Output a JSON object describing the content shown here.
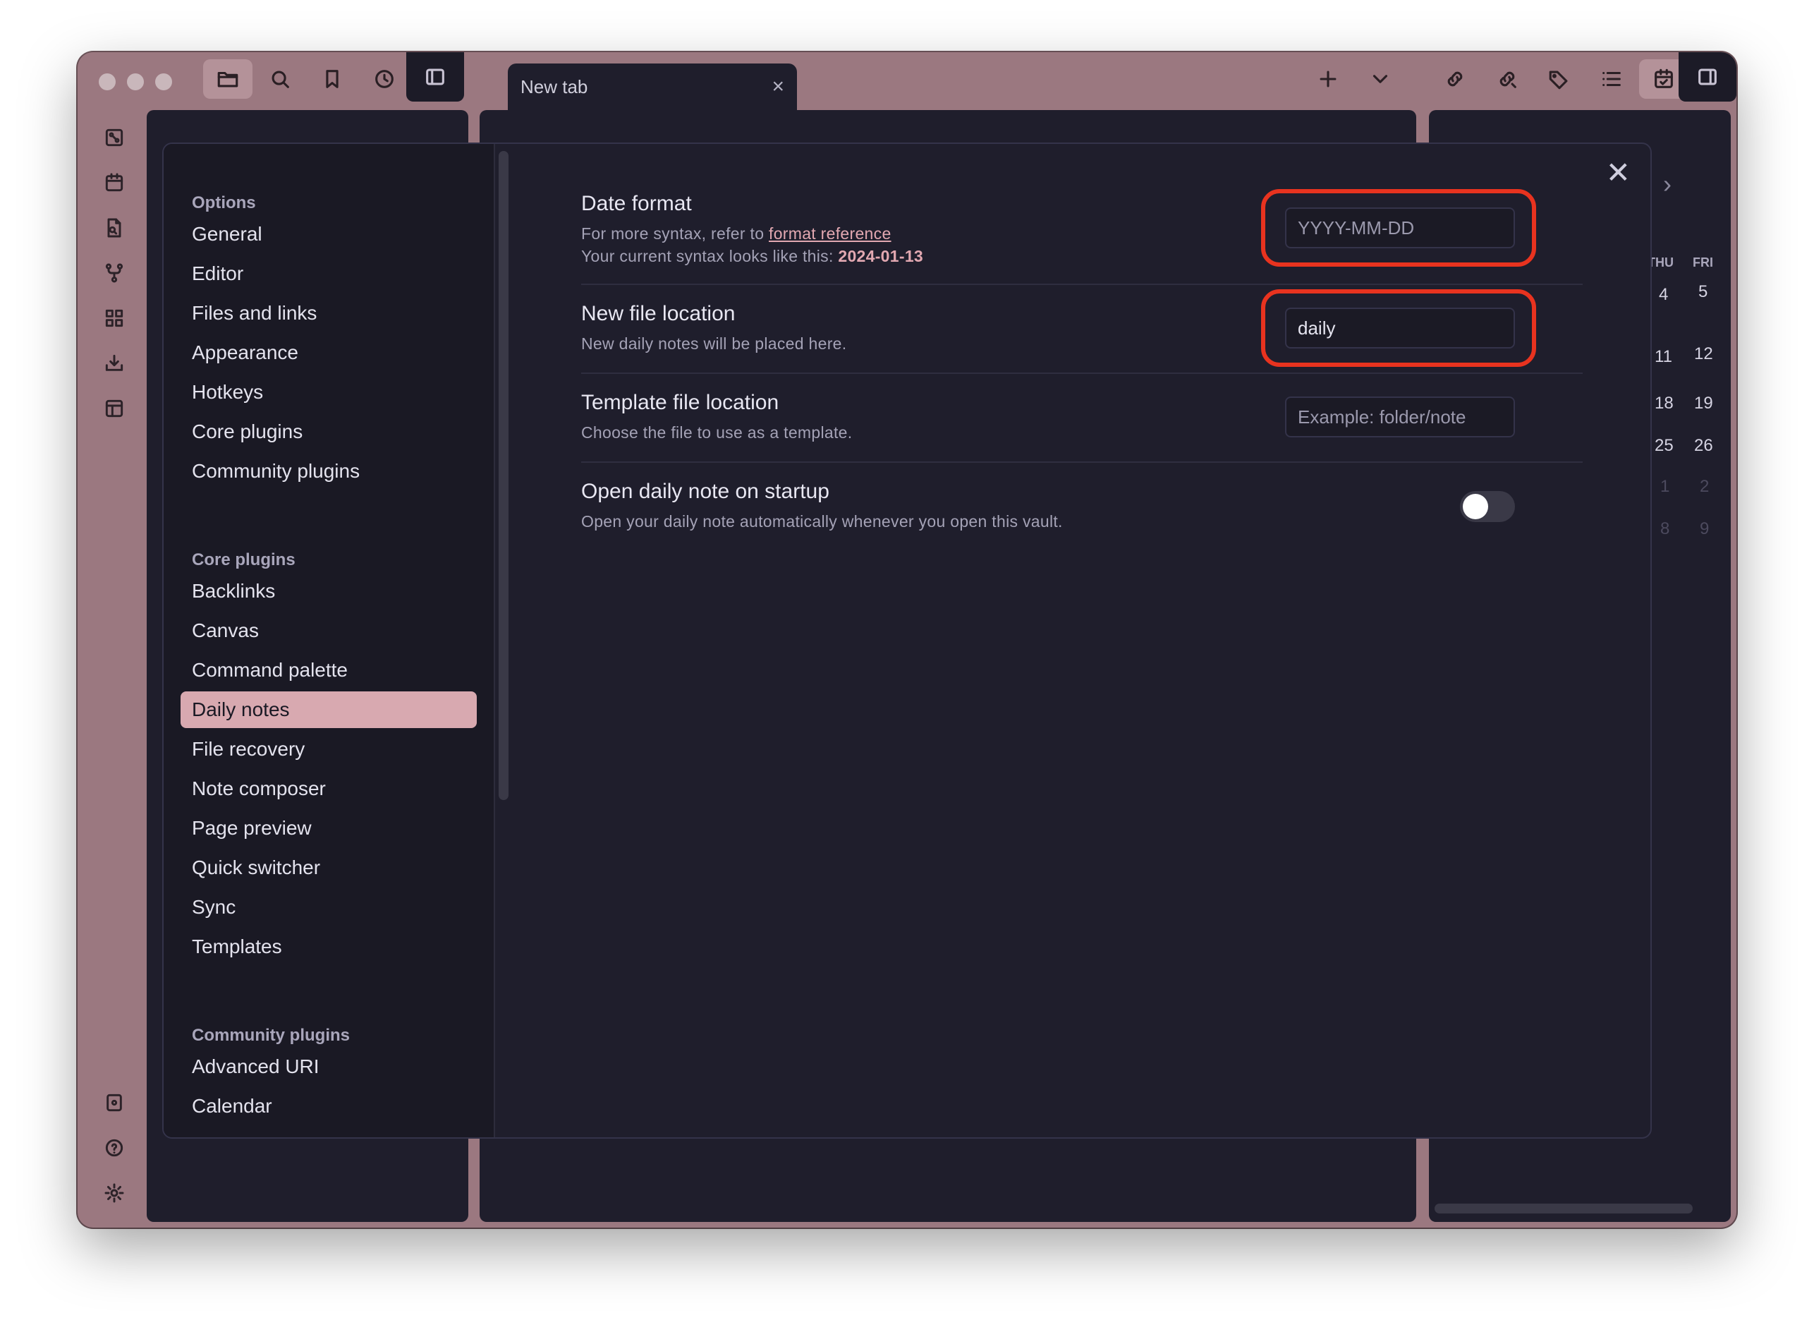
{
  "window": {
    "tab_title": "New tab",
    "tab_close": "×"
  },
  "modal": {
    "close": "✕",
    "sidebar": {
      "options_heading": "Options",
      "options": [
        "General",
        "Editor",
        "Files and links",
        "Appearance",
        "Hotkeys",
        "Core plugins",
        "Community plugins"
      ],
      "core_heading": "Core plugins",
      "core": [
        "Backlinks",
        "Canvas",
        "Command palette",
        "Daily notes",
        "File recovery",
        "Note composer",
        "Page preview",
        "Quick switcher",
        "Sync",
        "Templates"
      ],
      "community_heading": "Community plugins",
      "community": [
        "Advanced URI",
        "Calendar"
      ],
      "active_item": "Daily notes"
    },
    "settings": {
      "date_format": {
        "name": "Date format",
        "desc_prefix": "For more syntax, refer to ",
        "desc_link": "format reference",
        "desc_line2_prefix": "Your current syntax looks like this: ",
        "desc_line2_value": "2024-01-13",
        "placeholder": "YYYY-MM-DD"
      },
      "new_file_location": {
        "name": "New file location",
        "desc": "New daily notes will be placed here.",
        "value": "daily"
      },
      "template_location": {
        "name": "Template file location",
        "desc": "Choose the file to use as a template.",
        "placeholder": "Example: folder/note"
      },
      "open_on_startup": {
        "name": "Open daily note on startup",
        "desc": "Open your daily note automatically whenever you open this vault.",
        "enabled": false
      }
    }
  },
  "calendar": {
    "headers": [
      "THU",
      "FRI"
    ],
    "rows": [
      [
        "4",
        "5"
      ],
      [
        "11",
        "12"
      ],
      [
        "18",
        "19"
      ],
      [
        "25",
        "26"
      ],
      [
        "1",
        "2"
      ],
      [
        "8",
        "9"
      ]
    ]
  },
  "colors": {
    "window_bg": "#9b7880",
    "pane_bg": "#1f1e2c",
    "accent": "#d8a9b0",
    "highlight": "#e8331f"
  }
}
